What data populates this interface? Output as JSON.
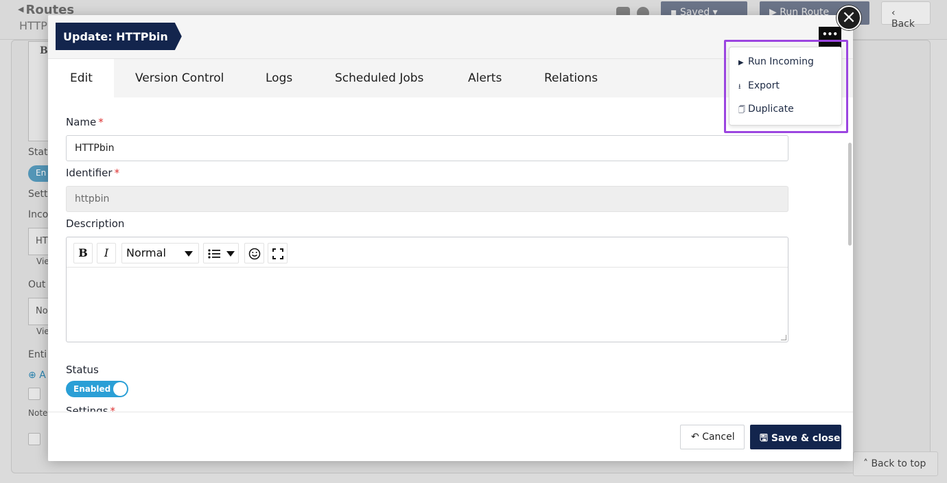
{
  "background": {
    "title": "Routes",
    "subtitle": "HTTP",
    "saved_label": "Saved",
    "run_route_label": "Run Route",
    "back_label": "Back",
    "back_to_top_label": "Back to top",
    "left_fragments": {
      "status": "Stat",
      "enabled": "En",
      "settings": "Sett",
      "incoming": "Inco",
      "incoming_value": "HT",
      "view1": "Vie",
      "outgoing": "Out",
      "outgoing_value": "No",
      "view2": "Vie",
      "entities": "Enti",
      "add": "A",
      "notes": "Note",
      "b_btn": "B"
    }
  },
  "modal": {
    "title": "Update: HTTPbin",
    "more_label": "•••",
    "close_icon": "×",
    "tabs": [
      {
        "label": "Edit",
        "active": true
      },
      {
        "label": "Version Control",
        "active": false
      },
      {
        "label": "Logs",
        "active": false
      },
      {
        "label": "Scheduled Jobs",
        "active": false
      },
      {
        "label": "Alerts",
        "active": false
      },
      {
        "label": "Relations",
        "active": false
      }
    ],
    "form": {
      "name_label": "Name",
      "name_value": "HTTPbin",
      "identifier_label": "Identifier",
      "identifier_value": "httpbin",
      "description_label": "Description",
      "editor": {
        "bold": "B",
        "italic": "I",
        "format_select": "Normal",
        "emoji_icon": "smiley-icon",
        "fullscreen_icon": "fullscreen-icon",
        "list_icon": "list-icon"
      },
      "status_label": "Status",
      "status_toggle": "Enabled",
      "settings_label": "Settings",
      "required_mark": "*"
    },
    "footer": {
      "cancel_label": "Cancel",
      "save_label": "Save & close"
    }
  },
  "dropdown_menu": {
    "items": [
      {
        "label": "Run Incoming",
        "icon": "play-icon",
        "glyph": "▶"
      },
      {
        "label": "Export",
        "icon": "download-icon",
        "glyph": "⭳"
      },
      {
        "label": "Duplicate",
        "icon": "copy-icon",
        "glyph": "🗍"
      }
    ]
  },
  "colors": {
    "primary_navy": "#13254d",
    "toggle_blue": "#2a9fd6",
    "highlight_purple": "#9b45e0",
    "required_red": "#dd3333"
  }
}
